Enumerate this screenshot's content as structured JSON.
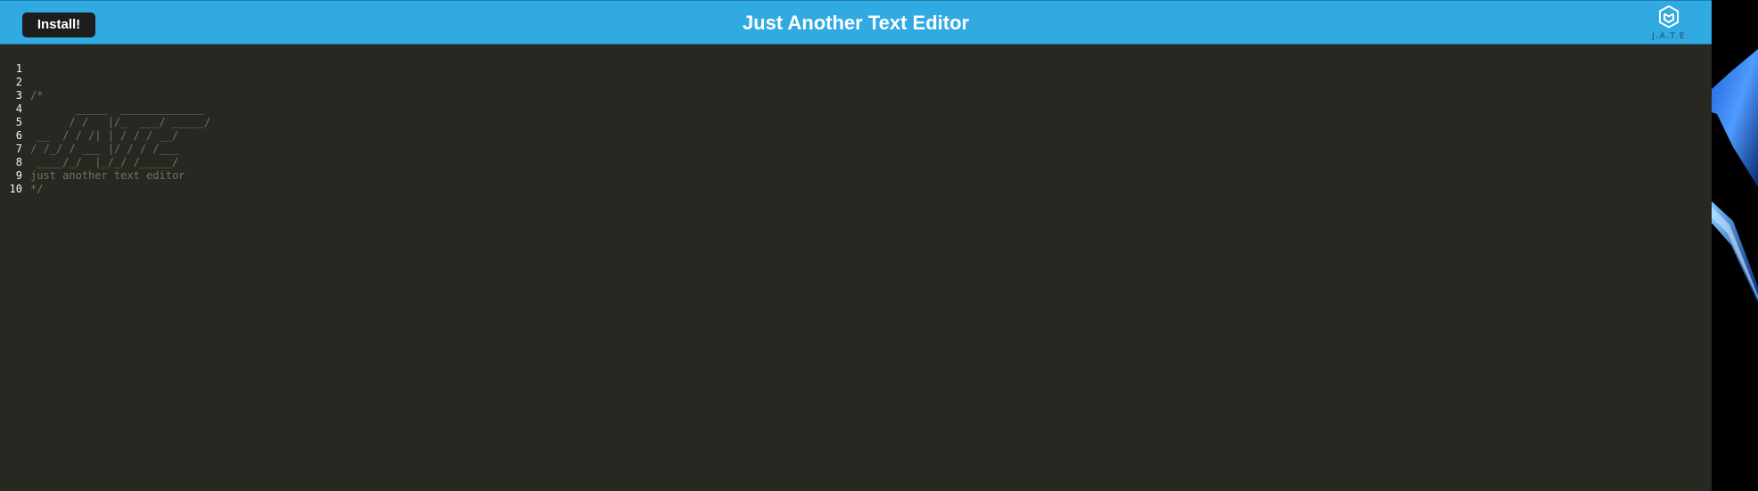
{
  "header": {
    "install_label": "Install!",
    "title": "Just Another Text Editor",
    "logo_text": "J.A.T.E"
  },
  "editor": {
    "lines": [
      {
        "num": "1",
        "text": ""
      },
      {
        "num": "2",
        "text": "/*"
      },
      {
        "num": "3",
        "text": "       _____  _____________"
      },
      {
        "num": "4",
        "text": "      / /   |/_  ___/ _____/"
      },
      {
        "num": "5",
        "text": " __  / / /| | / / / __/"
      },
      {
        "num": "6",
        "text": "/ /_/ / ___ |/ / / /___"
      },
      {
        "num": "7",
        "text": " ____/_/  |_/_/ /_____/"
      },
      {
        "num": "8",
        "text": "just another text editor"
      },
      {
        "num": "9",
        "text": "*/"
      },
      {
        "num": "10",
        "text": ""
      }
    ]
  },
  "colors": {
    "header_bg": "#31a9e1",
    "editor_bg": "#272822",
    "comment": "#75715e",
    "gutter_text": "#f8f8f2",
    "button_bg": "#1d1d1d"
  }
}
